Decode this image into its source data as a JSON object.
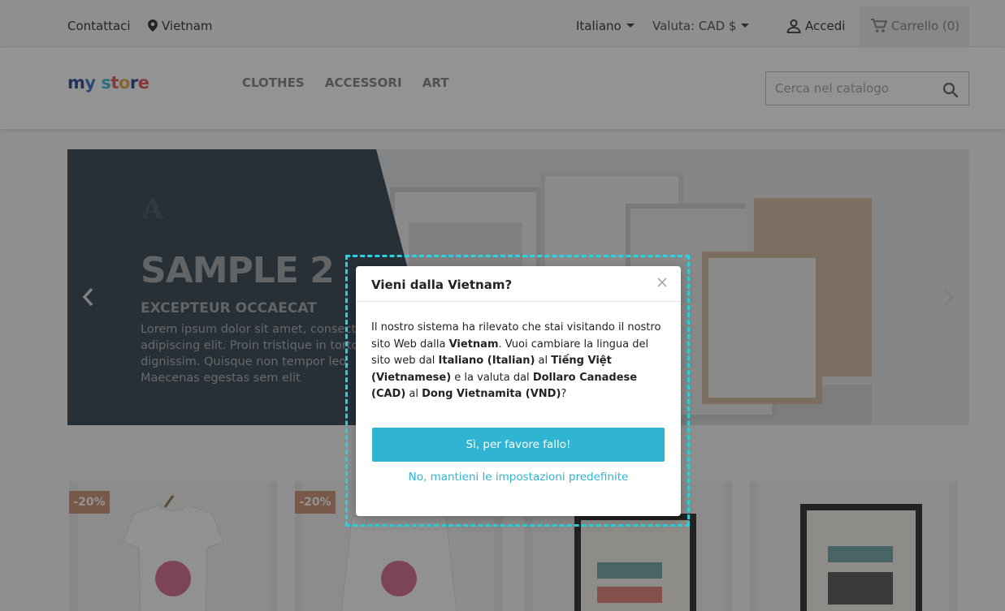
{
  "topbar": {
    "contact": "Contattaci",
    "location": "Vietnam",
    "language": "Italiano",
    "currency": "Valuta: CAD $",
    "login": "Accedi",
    "cart": "Carrello (0)"
  },
  "header": {
    "logo": "my store",
    "nav": [
      "CLOTHES",
      "ACCESSORI",
      "ART"
    ],
    "search_placeholder": "Cerca nel catalogo"
  },
  "slider": {
    "title": "SAMPLE 2",
    "subtitle": "EXCEPTEUR OCCAECAT",
    "text": "Lorem ipsum dolor sit amet, consectetur adipiscing elit. Proin tristique in tortor et dignissim. Quisque non tempor leo. Maecenas egestas sem elit"
  },
  "products": {
    "badges": [
      "-20%",
      "-20%"
    ]
  },
  "modal": {
    "title": "Vieni dalla Vietnam?",
    "body": {
      "p1": "Il nostro sistema ha rilevato che stai visitando il nostro sito Web dalla ",
      "country": "Vietnam",
      "p2": ". Vuoi cambiare la lingua del sito web dal ",
      "lang_from": "Italiano (Italian)",
      "p3": " al ",
      "lang_to": "Tiếng Việt (Vietnamese)",
      "p4": " e la valuta dal ",
      "curr_from": "Dollaro Canadese (CAD)",
      "p5": " al ",
      "curr_to": "Dong Vietnamita (VND)",
      "p6": "?"
    },
    "confirm": "Sì, per favore fallo!",
    "decline": "No, mantieni le impostazioni predefinite"
  },
  "colors": {
    "accent": "#2fb5d2",
    "highlight": "#2ad3e0",
    "badge": "#c98a6a"
  }
}
